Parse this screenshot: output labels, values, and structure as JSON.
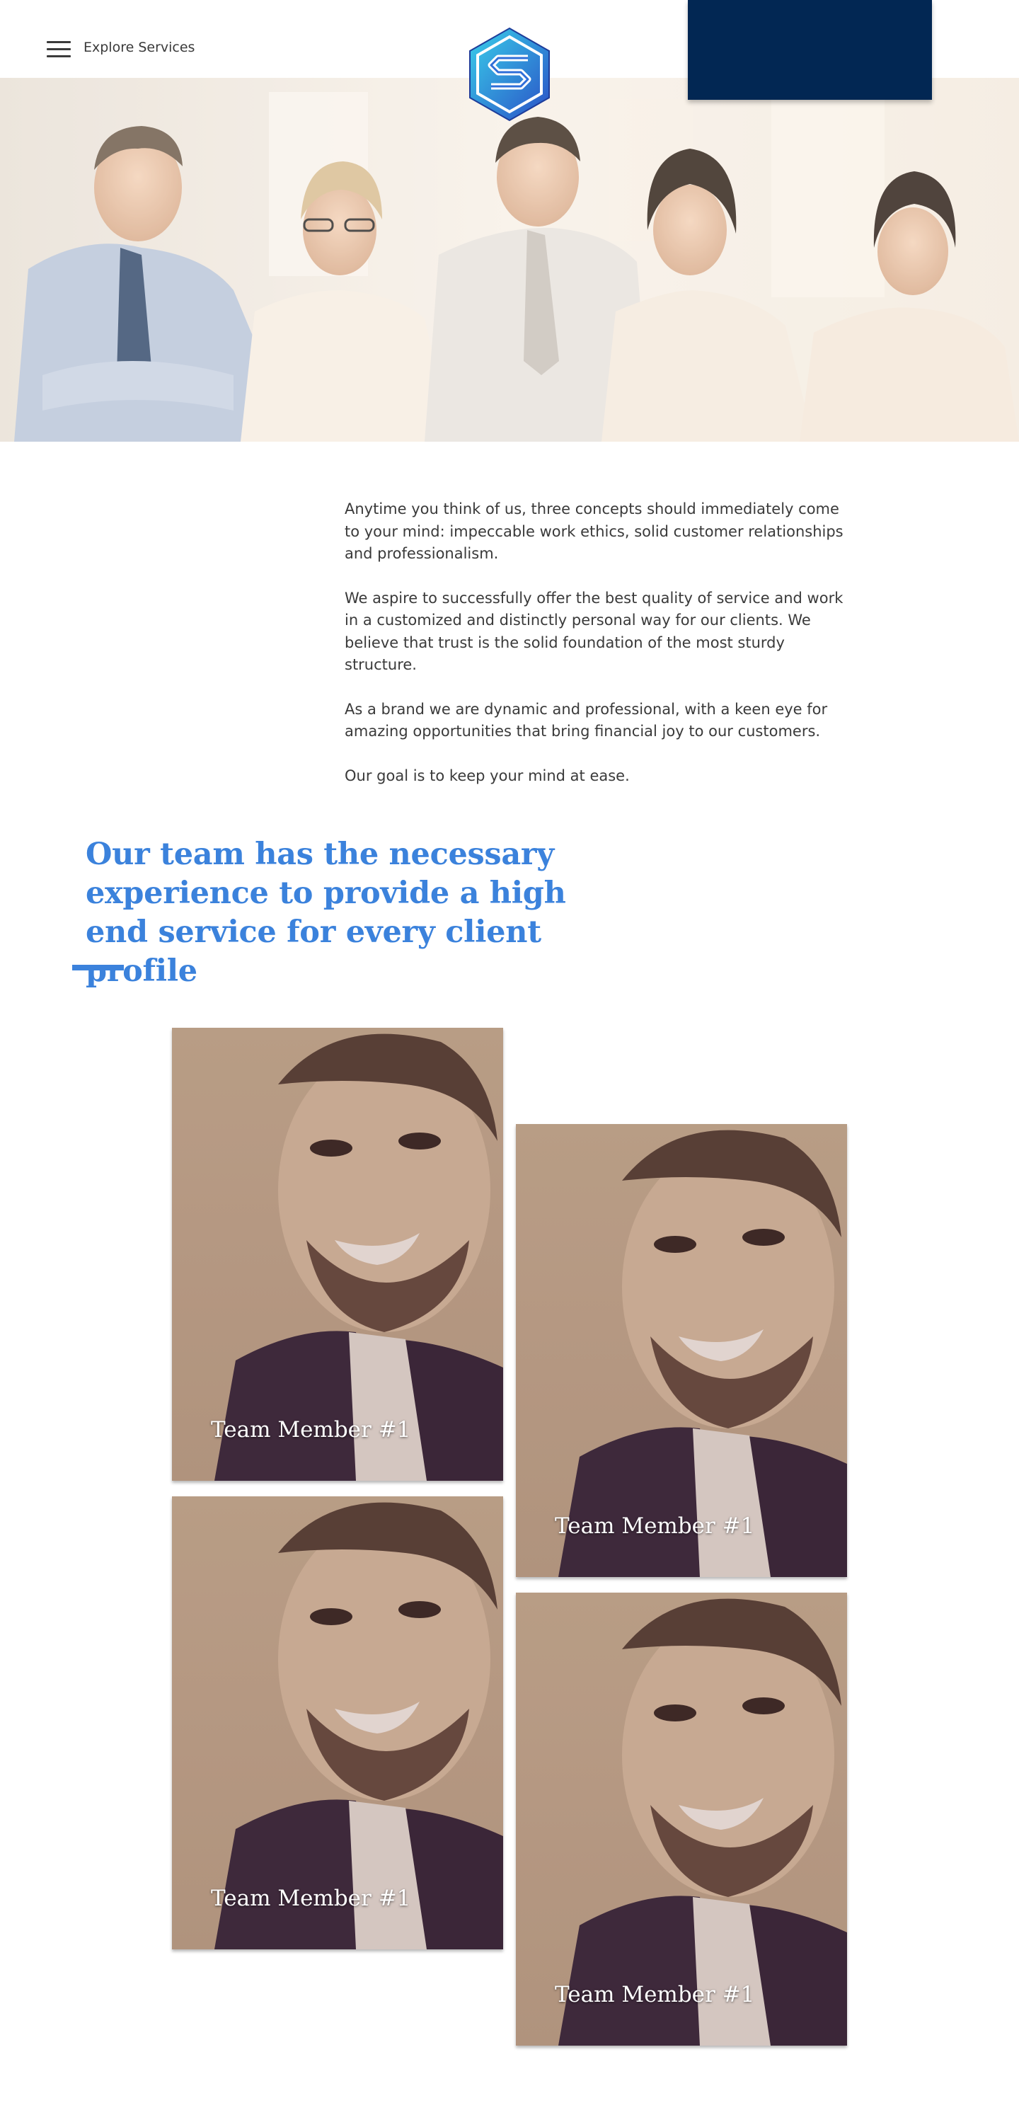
{
  "header": {
    "menu_label": "Explore Services",
    "colors": {
      "panel": "#022753",
      "logo_light": "#35c6e6",
      "logo_dark": "#2b55c9"
    }
  },
  "intro": {
    "paragraphs": [
      "Anytime you think of us, three concepts should immediately come to your mind: impeccable work ethics, solid customer relationships and professionalism.",
      "We aspire to successfully offer the best quality of service and work in a customized and distinctly personal way for our clients. We believe that trust is the solid foundation of the most sturdy structure.",
      "As a brand we are dynamic and professional, with a keen eye for amazing opportunities that bring financial joy to our customers.",
      "Our goal is to keep your mind at ease."
    ]
  },
  "team": {
    "title": "Our team has the necessary experience to provide a high end service for every client profile",
    "accent_color": "#3b82dc",
    "members": [
      {
        "name": "Team Member #1"
      },
      {
        "name": "Team Member #1"
      },
      {
        "name": "Team Member #1"
      },
      {
        "name": "Team Member #1"
      }
    ]
  }
}
